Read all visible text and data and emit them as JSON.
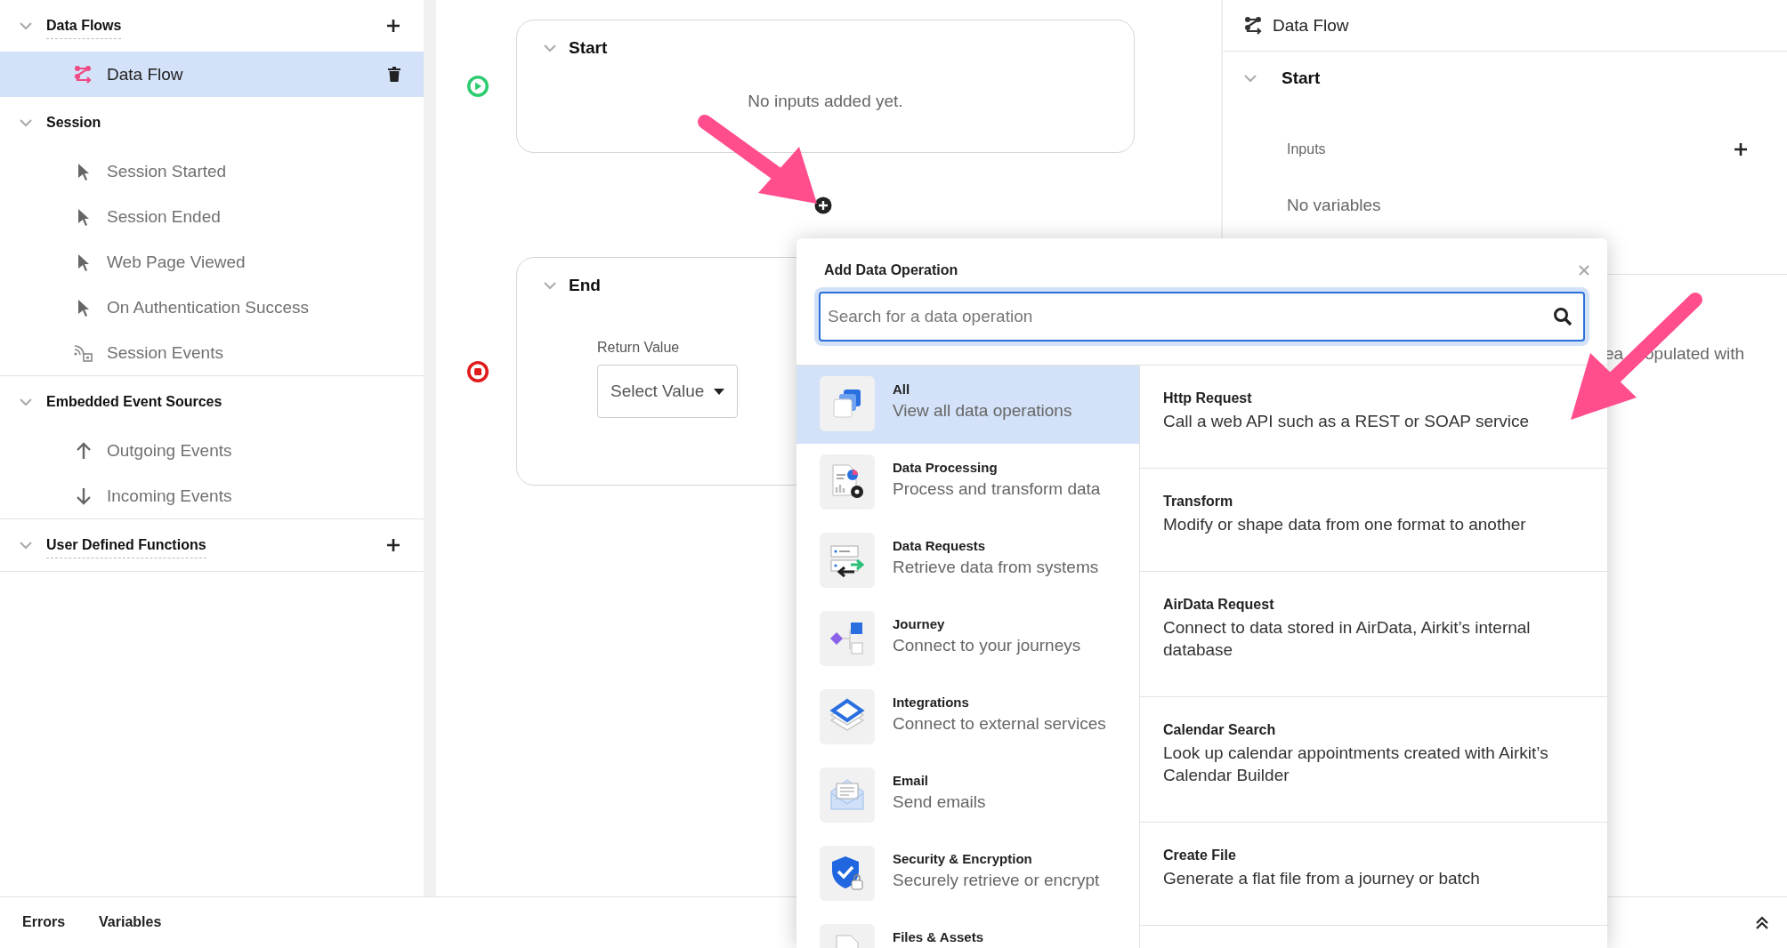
{
  "sidebar": {
    "sections": [
      {
        "title": "Data Flows",
        "expanded": true,
        "addable": true,
        "items": [
          {
            "label": "Data Flow",
            "kind": "flow",
            "selected": true,
            "deletable": true
          }
        ]
      },
      {
        "title": "Session",
        "expanded": true,
        "addable": false,
        "items": [
          {
            "label": "Session Started",
            "kind": "pointer",
            "selected": false,
            "deletable": false
          },
          {
            "label": "Session Ended",
            "kind": "pointer",
            "selected": false,
            "deletable": false
          },
          {
            "label": "Web Page Viewed",
            "kind": "pointer",
            "selected": false,
            "deletable": false
          },
          {
            "label": "On Authentication Success",
            "kind": "pointer",
            "selected": false,
            "deletable": false
          },
          {
            "label": "Session Events",
            "kind": "feed",
            "selected": false,
            "deletable": false
          }
        ]
      },
      {
        "title": "Embedded Event Sources",
        "expanded": true,
        "addable": false,
        "items": [
          {
            "label": "Outgoing Events",
            "kind": "up",
            "selected": false,
            "deletable": false
          },
          {
            "label": "Incoming Events",
            "kind": "down",
            "selected": false,
            "deletable": false
          }
        ]
      },
      {
        "title": "User Defined Functions",
        "expanded": true,
        "addable": true
      }
    ]
  },
  "canvas": {
    "start": {
      "title": "Start",
      "expanded": true,
      "message": "No inputs added yet."
    },
    "end": {
      "title": "End",
      "expanded": true,
      "return_label": "Return Value",
      "select": {
        "value": "Select Value"
      }
    }
  },
  "right_panel": {
    "title": "Data Flow",
    "section": {
      "title": "Start",
      "expanded": true,
      "inputs_label": "Inputs",
      "empty_text": "No variables"
    },
    "text_fragments": [
      "ea",
      "opulated with"
    ]
  },
  "dialog": {
    "title": "Add Data Operation",
    "search": {
      "placeholder": "Search for a data operation"
    },
    "categories": [
      {
        "name": "All",
        "description": "View all data operations",
        "kind": "stack",
        "selected": true
      },
      {
        "name": "Data Processing",
        "description": "Process and transform data",
        "kind": "report",
        "selected": false
      },
      {
        "name": "Data Requests",
        "description": "Retrieve data from systems",
        "kind": "transfer",
        "selected": false
      },
      {
        "name": "Journey",
        "description": "Connect to your journeys",
        "kind": "journey",
        "selected": false
      },
      {
        "name": "Integrations",
        "description": "Connect to external services",
        "kind": "layers",
        "selected": false
      },
      {
        "name": "Email",
        "description": "Send emails",
        "kind": "mail",
        "selected": false
      },
      {
        "name": "Security & Encryption",
        "description": "Securely retrieve or encrypt",
        "kind": "shield",
        "selected": false
      },
      {
        "name": "Files & Assets",
        "kind": "file",
        "selected": false
      }
    ],
    "operations": [
      {
        "name": "Http Request",
        "description": "Call a web API such as a REST or SOAP service"
      },
      {
        "name": "Transform",
        "description": "Modify or shape data from one format to another"
      },
      {
        "name": "AirData Request",
        "description": "Connect to data stored in AirData, Airkit’s internal database"
      },
      {
        "name": "Calendar Search",
        "description": "Look up calendar appointments created with Airkit’s Calendar Builder"
      },
      {
        "name": "Create File",
        "description": "Generate a flat file from a journey or batch"
      }
    ]
  },
  "bottom_bar": {
    "tabs": [
      {
        "label": "Errors",
        "selected": false
      },
      {
        "label": "Variables",
        "selected": false
      }
    ]
  }
}
